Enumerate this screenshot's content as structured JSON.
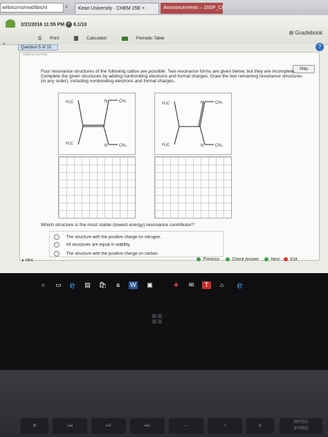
{
  "browser": {
    "url_fragment": "w/ibiscms/mod/ibis/vi",
    "tab_active": "Kean University · CHEM 25E ×",
    "tab_other": "Announcements – 16SP_CHE..."
  },
  "header": {
    "datetime": "2/21/2016 11:55 PM",
    "score": "6.1/10",
    "gradebook_label": "Gradebook",
    "print_label": "Print",
    "calculator_label": "Calculator",
    "periodic_table_label": "Periodic Table",
    "question_counter": "Question 5 of 10",
    "help_glyph": "?"
  },
  "content": {
    "brand": "sapling learning",
    "map_label": "Map",
    "instructions": "Four resonance structures of the following cation are possible. Two resonance forms are given below, but they are incomplete. Complete the given structures by adding nonbonding electrons and formal charges. Draw the two remaining resonance structures (in any order), including nonbonding electrons and formal charges.",
    "struct1": {
      "tl": "H₃C",
      "tr": "CH₃",
      "bl": "H₃C",
      "br": "CH₃",
      "n": "N"
    },
    "struct2": {
      "tl": "H₃C",
      "tr": "CH₃",
      "bl": "H₃C",
      "br": "CH₃",
      "n": "N"
    },
    "question": "Which structure is the most stable (lowest energy) resonance contributor?",
    "answers": [
      "The structure with the positive charge on nitrogen.",
      "All structures are equal in stability.",
      "The structure with the positive charge on carbon."
    ]
  },
  "footer": {
    "hint_label": "Hint",
    "previous_label": "Previous",
    "check_label": "Check Answer",
    "next_label": "Next",
    "exit_label": "Exit"
  },
  "taskbar": {
    "store_letter": "a",
    "amazon_letter": "a",
    "word_letter": "W"
  },
  "keyboard": {
    "prtsc": "PRTSC",
    "sysrq": "SYSRQ"
  },
  "colors": {
    "tab_highlight": "#b04a4a",
    "help_blue": "#2d6fb8",
    "check_green": "#3aa34a",
    "exit_red": "#d03a2a"
  }
}
